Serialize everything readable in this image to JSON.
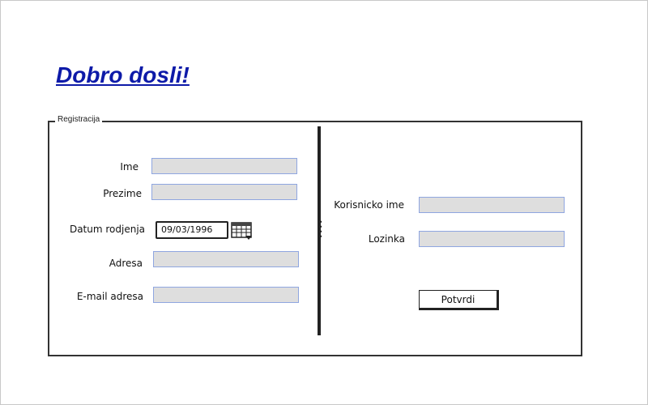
{
  "header": {
    "title": "Dobro dosli!"
  },
  "registration": {
    "legend": "Registracija",
    "left": {
      "first_name_label": "Ime",
      "first_name_value": "",
      "last_name_label": "Prezime",
      "last_name_value": "",
      "birthdate_label": "Datum rodjenja",
      "birthdate_value": "09/03/1996",
      "address_label": "Adresa",
      "address_value": "",
      "email_label": "E-mail adresa",
      "email_value": ""
    },
    "right": {
      "username_label": "Korisnicko ime",
      "username_value": "",
      "password_label": "Lozinka",
      "password_value": "",
      "submit_label": "Potvrdi"
    }
  },
  "icons": {
    "date_picker": "calendar-icon",
    "divider_grip": "drag-handle-icon"
  },
  "colors": {
    "title": "#0d1aa8",
    "input_fill": "#dedede",
    "input_border": "#8fa6e0"
  }
}
